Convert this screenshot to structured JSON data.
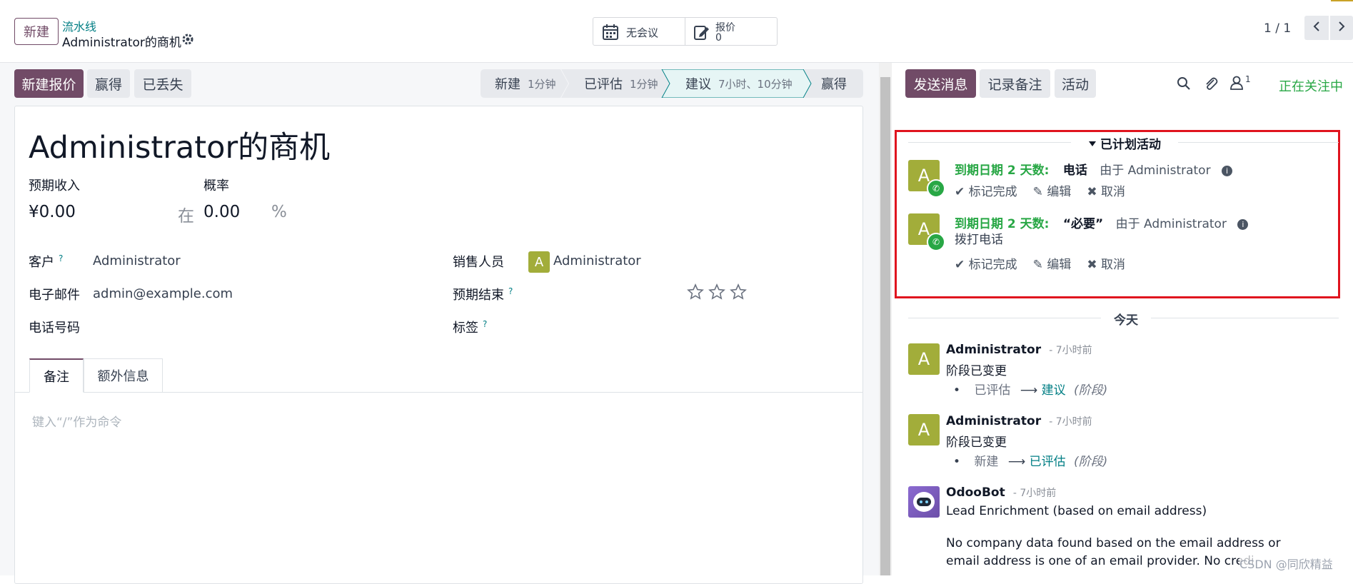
{
  "topbar": {
    "new_label": "新建",
    "breadcrumb_link": "流水线",
    "breadcrumb_current": "Administrator的商机",
    "meetings_label": "无会议",
    "quotes_label": "报价",
    "quotes_count": "0",
    "pager": "1 / 1"
  },
  "actions": {
    "new_quote": "新建报价",
    "won": "赢得",
    "lost": "已丢失"
  },
  "stages": [
    {
      "name": "新建",
      "duration": "1分钟",
      "active": false
    },
    {
      "name": "已评估",
      "duration": "1分钟",
      "active": false
    },
    {
      "name": "建议",
      "duration": "7小时、10分钟",
      "active": true
    },
    {
      "name": "赢得",
      "duration": "",
      "active": false
    }
  ],
  "form": {
    "title": "Administrator的商机",
    "expected_revenue_label": "预期收入",
    "probability_label": "概率",
    "expected_revenue_value": "¥0.00",
    "at_label": "在",
    "probability_value": "0.00",
    "percent": "%",
    "customer_label": "客户",
    "customer_value": "Administrator",
    "email_label": "电子邮件",
    "email_value": "admin@example.com",
    "phone_label": "电话号码",
    "salesperson_label": "销售人员",
    "salesperson_avatar": "A",
    "salesperson_value": "Administrator",
    "expected_closing_label": "预期结束",
    "tags_label": "标签",
    "help_mark": "?",
    "priority_stars": 0,
    "tabs": [
      "备注",
      "额外信息"
    ],
    "note_placeholder": "键入“/”作为命令"
  },
  "chatter": {
    "send_message": "发送消息",
    "log_note": "记录备注",
    "activity": "活动",
    "followers_count": "1",
    "following": "正在关注中",
    "planned_header": "已计划活动",
    "planned": [
      {
        "avatar": "A",
        "due": "到期日期 2 天数:",
        "type": "电话",
        "by": "由于 Administrator",
        "note": "",
        "mark_done": "标记完成",
        "edit": "编辑",
        "cancel": "取消"
      },
      {
        "avatar": "A",
        "due": "到期日期 2 天数:",
        "type": "“必要”",
        "by": "由于 Administrator",
        "note": "拨打电话",
        "mark_done": "标记完成",
        "edit": "编辑",
        "cancel": "取消"
      }
    ],
    "today_label": "今天",
    "messages": [
      {
        "author": "Administrator",
        "time": "- 7小时前",
        "body": "阶段已变更",
        "from": "已评估",
        "to": "建议",
        "field": "(阶段)"
      },
      {
        "author": "Administrator",
        "time": "- 7小时前",
        "body": "阶段已变更",
        "from": "新建",
        "to": "已评估",
        "field": "(阶段)"
      },
      {
        "author": "OdooBot",
        "time": "- 7小时前",
        "body": "Lead Enrichment (based on email address)",
        "detail1": "No company data found based on the email address or",
        "detail2": "email address is one of an email provider. No credit was"
      }
    ]
  },
  "watermark": "CSDN @同欣精益",
  "colors": {
    "primary": "#714b67",
    "link": "#017e84",
    "success": "#28a745",
    "avatar": "#a2ad3a",
    "highlight_box": "#e0141e"
  }
}
